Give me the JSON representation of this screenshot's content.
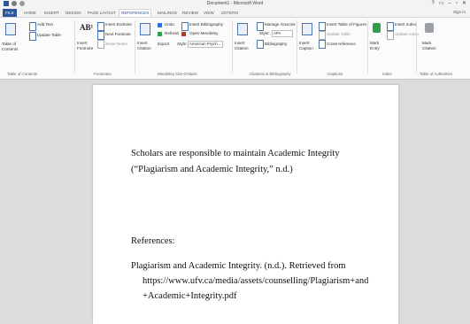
{
  "window": {
    "title": "Document1 - Microsoft Word",
    "controls": [
      "?",
      "▭",
      "–",
      "▫",
      "✕"
    ],
    "sign_in": "Sign in"
  },
  "tabs": [
    "FILE",
    "HOME",
    "INSERT",
    "DESIGN",
    "PAGE LAYOUT",
    "REFERENCES",
    "MAILINGS",
    "REVIEW",
    "VIEW",
    "ZOTERO"
  ],
  "ribbon": {
    "toc": {
      "table_of_contents": "Table of Contents",
      "add_text": "Add Text",
      "update_table": "Update Table",
      "group": "Table of Contents"
    },
    "footnotes": {
      "insert_footnote": "Insert Footnote",
      "insert_endnote": "Insert Endnote",
      "next_footnote": "Next Footnote",
      "show_notes": "Show Notes",
      "ab_label": "AB¹",
      "group": "Footnotes"
    },
    "zotero": {
      "insert_citation": "Insert Citation",
      "undo": "Undo",
      "refresh": "Refresh",
      "export": "Export",
      "insert_bibliography": "Insert Bibliography",
      "open_mendeley": "Open Mendeley",
      "style_label": "Style:",
      "style_value": "American Psych...",
      "group": "Mendeley Cite-O-Matic"
    },
    "citations": {
      "insert_citation": "Insert Citation",
      "manage_sources": "Manage Sources",
      "style_label": "Style:",
      "style_value": "APA",
      "bibliography": "Bibliography",
      "group": "Citations & Bibliography"
    },
    "captions": {
      "insert_caption": "Insert Caption",
      "insert_tof": "Insert Table of Figures",
      "update_table": "Update Table",
      "cross_reference": "Cross-reference",
      "group": "Captions"
    },
    "index": {
      "mark_entry": "Mark Entry",
      "insert_index": "Insert Index",
      "update_index": "Update Index",
      "group": "Index"
    },
    "toa": {
      "mark_citation": "Mark Citation",
      "group": "Table of Authorities"
    }
  },
  "document": {
    "body_line1": "Scholars are responsible to maintain Academic Integrity",
    "body_line2": "(“Plagiarism and Academic Integrity,” n.d.)",
    "references_heading": "References:",
    "ref_line1": "Plagiarism and Academic Integrity. (n.d.). Retrieved from",
    "ref_line2": "https://www.ufv.ca/media/assets/counselling/Plagiarism+and",
    "ref_line3": "+Academic+Integrity.pdf"
  }
}
